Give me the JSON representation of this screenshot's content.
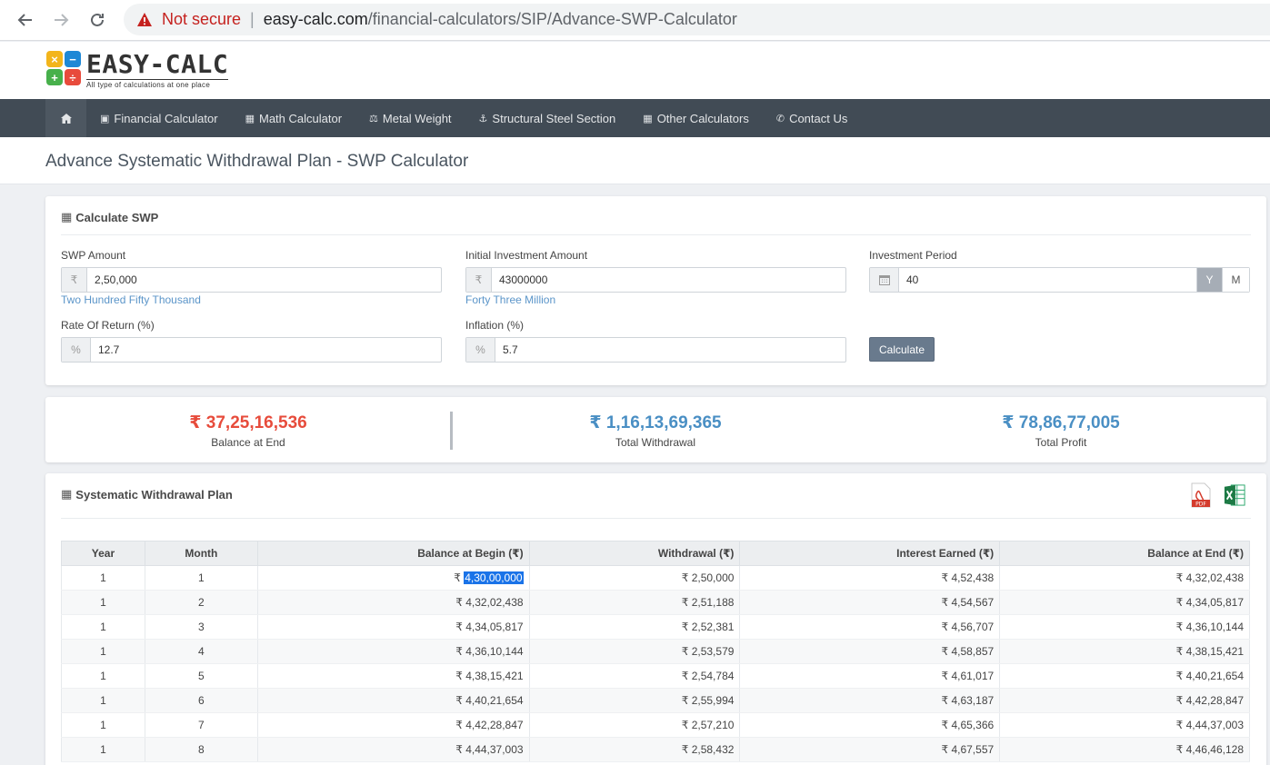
{
  "browser": {
    "security_label": "Not secure",
    "separator": "|",
    "url_host": "easy-calc.com",
    "url_path": "/financial-calculators/SIP/Advance-SWP-Calculator"
  },
  "site": {
    "logo_title": "EASY-CALC",
    "logo_subtitle": "All type of calculations at one place",
    "logo_signs": [
      "×",
      "−",
      "+",
      "÷"
    ]
  },
  "nav": {
    "items": [
      "Financial Calculator",
      "Math Calculator",
      "Metal Weight",
      "Structural Steel Section",
      "Other Calculators",
      "Contact Us"
    ]
  },
  "page": {
    "title": "Advance Systematic Withdrawal Plan - SWP Calculator"
  },
  "form": {
    "heading": "Calculate SWP",
    "swp_amount": {
      "label": "SWP Amount",
      "addon": "₹",
      "value": "2,50,000",
      "words": "Two Hundred Fifty Thousand"
    },
    "initial_investment": {
      "label": "Initial Investment Amount",
      "addon": "₹",
      "value": "43000000",
      "words": "Forty Three Million"
    },
    "investment_period": {
      "label": "Investment Period",
      "value": "40",
      "unit_y": "Y",
      "unit_m": "M"
    },
    "rate_of_return": {
      "label": "Rate Of Return (%)",
      "addon": "%",
      "value": "12.7"
    },
    "inflation": {
      "label": "Inflation (%)",
      "addon": "%",
      "value": "5.7"
    },
    "calculate_label": "Calculate"
  },
  "summary": {
    "balance_end": {
      "value": "₹ 37,25,16,536",
      "label": "Balance at End",
      "color": "#e74c3c"
    },
    "total_withdrawal": {
      "value": "₹ 1,16,13,69,365",
      "label": "Total Withdrawal",
      "color": "#4a8fc4"
    },
    "total_profit": {
      "value": "₹ 78,86,77,005",
      "label": "Total Profit",
      "color": "#4a8fc4"
    }
  },
  "plan": {
    "heading": "Systematic Withdrawal Plan",
    "pdf_label": "PDF",
    "columns": [
      "Year",
      "Month",
      "Balance at Begin (₹)",
      "Withdrawal (₹)",
      "Interest Earned (₹)",
      "Balance at End (₹)"
    ],
    "currency": "₹",
    "rows": [
      [
        "1",
        "1",
        "4,30,00,000",
        "2,50,000",
        "4,52,438",
        "4,32,02,438"
      ],
      [
        "1",
        "2",
        "4,32,02,438",
        "2,51,188",
        "4,54,567",
        "4,34,05,817"
      ],
      [
        "1",
        "3",
        "4,34,05,817",
        "2,52,381",
        "4,56,707",
        "4,36,10,144"
      ],
      [
        "1",
        "4",
        "4,36,10,144",
        "2,53,579",
        "4,58,857",
        "4,38,15,421"
      ],
      [
        "1",
        "5",
        "4,38,15,421",
        "2,54,784",
        "4,61,017",
        "4,40,21,654"
      ],
      [
        "1",
        "6",
        "4,40,21,654",
        "2,55,994",
        "4,63,187",
        "4,42,28,847"
      ],
      [
        "1",
        "7",
        "4,42,28,847",
        "2,57,210",
        "4,65,366",
        "4,44,37,003"
      ],
      [
        "1",
        "8",
        "4,44,37,003",
        "2,58,432",
        "4,67,557",
        "4,46,46,128"
      ]
    ]
  }
}
